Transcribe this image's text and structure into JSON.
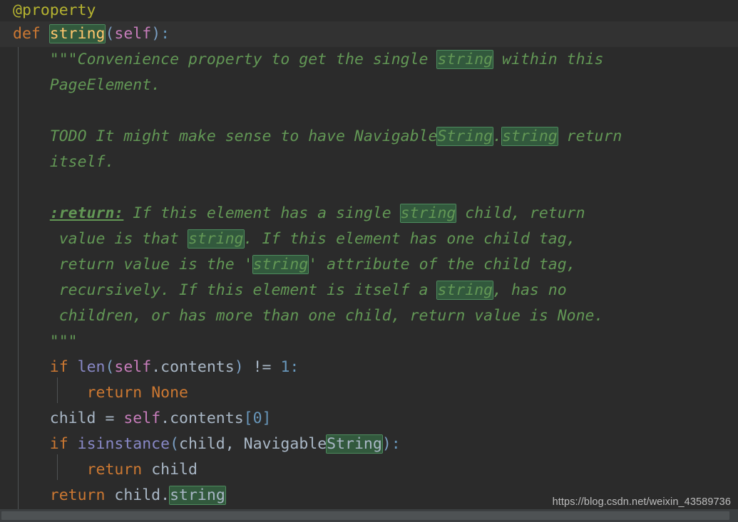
{
  "app": {
    "type": "code-editor",
    "language": "python",
    "theme": "darcula-dark"
  },
  "colors": {
    "background": "#2b2b2b",
    "current_line": "#323232",
    "keyword": "#cc7832",
    "decorator": "#b5b330",
    "function_name": "#ffc66d",
    "self_keyword": "#c77dbb",
    "builtin": "#8888c6",
    "number": "#6897bb",
    "identifier": "#a9b7c6",
    "docstring": "#629755",
    "search_highlight_bg": "#32593d",
    "search_highlight_border": "#4e8c5e",
    "scrollbar_track": "#3c3f41",
    "scrollbar_thumb": "#4e5254",
    "watermark": "#c9c9c9"
  },
  "search": {
    "query": "string",
    "match_count": 9
  },
  "code": {
    "lines": [
      {
        "id": "l1",
        "text": "@property"
      },
      {
        "id": "l2",
        "text": "def string(self):"
      },
      {
        "id": "l3",
        "text": "    \"\"\"Convenience property to get the single string within this"
      },
      {
        "id": "l4",
        "text": "    PageElement."
      },
      {
        "id": "l5",
        "text": ""
      },
      {
        "id": "l6",
        "text": "    TODO It might make sense to have NavigableString.string return"
      },
      {
        "id": "l7",
        "text": "    itself."
      },
      {
        "id": "l8",
        "text": ""
      },
      {
        "id": "l9",
        "text": "    :return: If this element has a single string child, return"
      },
      {
        "id": "l10",
        "text": "     value is that string. If this element has one child tag,"
      },
      {
        "id": "l11",
        "text": "     return value is the 'string' attribute of the child tag,"
      },
      {
        "id": "l12",
        "text": "     recursively. If this element is itself a string, has no"
      },
      {
        "id": "l13",
        "text": "     children, or has more than one child, return value is None."
      },
      {
        "id": "l14",
        "text": "    \"\"\""
      },
      {
        "id": "l15",
        "text": "    if len(self.contents) != 1:"
      },
      {
        "id": "l16",
        "text": "        return None"
      },
      {
        "id": "l17",
        "text": "    child = self.contents[0]"
      },
      {
        "id": "l18",
        "text": "    if isinstance(child, NavigableString):"
      },
      {
        "id": "l19",
        "text": "        return child"
      },
      {
        "id": "l20",
        "text": "    return child.string"
      }
    ]
  },
  "tokens": {
    "decorator_property": "@property",
    "kw_def": "def",
    "fn_string": "string",
    "paren_open": "(",
    "self": "self",
    "paren_close": ")",
    "colon": ":",
    "doc_open_quotes": "\"\"\"",
    "doc_line1_a": "Convenience property to get the single ",
    "doc_line1_hit": "string",
    "doc_line1_b": " within this",
    "doc_line2": "PageElement.",
    "doc_line3_a": "TODO It might make sense to have Navigable",
    "doc_line3_hit1": "String",
    "doc_line3_dot": ".",
    "doc_line3_hit2": "string",
    "doc_line3_b": " return",
    "doc_line4": "itself.",
    "doc_tag_return": ":return:",
    "doc_line5_a": " If this element has a single ",
    "doc_line5_hit": "string",
    "doc_line5_b": " child, return",
    "doc_line6_a": " value is that ",
    "doc_line6_hit": "string",
    "doc_line6_b": ". If this element has one child tag,",
    "doc_line7_a": " return value is the '",
    "doc_line7_hit": "string",
    "doc_line7_b": "' attribute of the child tag,",
    "doc_line8_a": " recursively. If this element is itself a ",
    "doc_line8_hit": "string",
    "doc_line8_b": ", has no",
    "doc_line9": " children, or has more than one child, return value is None.",
    "doc_close_quotes": "\"\"\"",
    "kw_if": "if",
    "builtin_len": "len",
    "attr_contents": ".contents",
    "op_neq": " != ",
    "num_one": "1",
    "kw_return": "return",
    "kw_none": "None",
    "var_child": "child",
    "op_assign": " = ",
    "index_open": "[",
    "num_zero": "0",
    "index_close": "]",
    "builtin_isinstance": "isinstance",
    "comma_space": ", ",
    "cls_navigable": "Navigable",
    "cls_string_hit": "String",
    "dot": ".",
    "attr_string_hit": "string"
  },
  "watermark": {
    "text": "https://blog.csdn.net/weixin_43589736"
  },
  "scrollbar": {
    "orientation": "horizontal",
    "position_percent": 0
  }
}
